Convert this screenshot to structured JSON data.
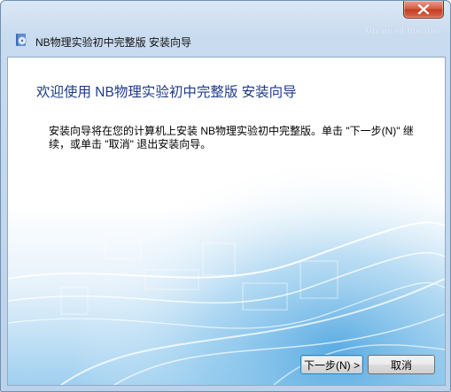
{
  "window": {
    "title": "NB物理实验初中完整版 安装向导",
    "brand": "Advanced Installer"
  },
  "content": {
    "heading": "欢迎使用 NB物理实验初中完整版 安装向导",
    "description": "安装向导将在您的计算机上安装 NB物理实验初中完整版。单击 \"下一步(N)\" 继续，或单击 \"取消\" 退出安装向导。"
  },
  "buttons": {
    "next": "下一步(N) >",
    "cancel": "取消"
  },
  "icons": {
    "app": "installer-cd-icon",
    "close": "close-icon"
  },
  "colors": {
    "heading": "#1e3a8a",
    "close_button": "#c23b22"
  }
}
